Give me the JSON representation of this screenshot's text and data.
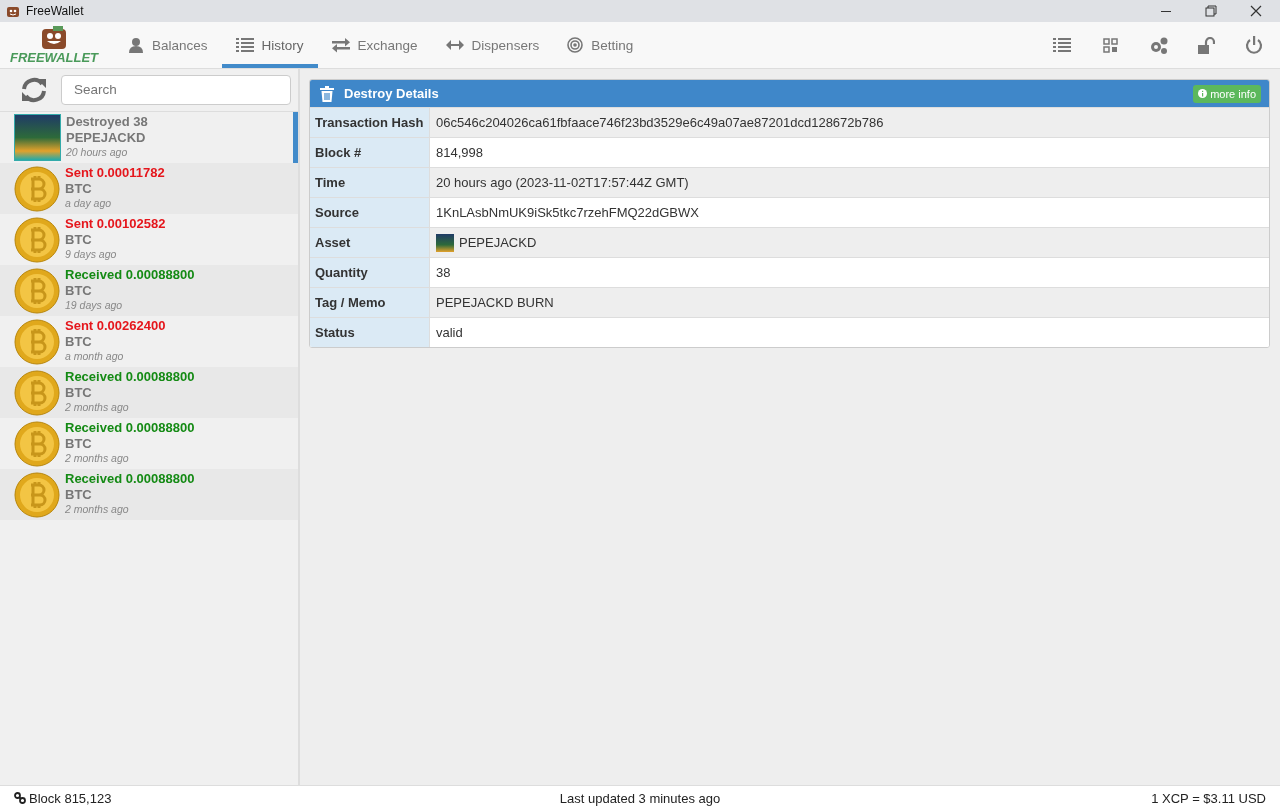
{
  "window": {
    "title": "FreeWallet"
  },
  "logo": {
    "text": "FREEWALLET"
  },
  "tabs": [
    {
      "label": "Balances",
      "selected": false
    },
    {
      "label": "History",
      "selected": true
    },
    {
      "label": "Exchange",
      "selected": false
    },
    {
      "label": "Dispensers",
      "selected": false
    },
    {
      "label": "Betting",
      "selected": false
    }
  ],
  "search": {
    "placeholder": "Search"
  },
  "history": [
    {
      "kind": "destroy",
      "title": "Destroyed 38",
      "asset": "PEPEJACKD",
      "time": "20 hours ago",
      "selected": true
    },
    {
      "kind": "sent",
      "title": "Sent 0.00011782",
      "asset": "BTC",
      "time": "a day ago",
      "selected": false
    },
    {
      "kind": "sent",
      "title": "Sent 0.00102582",
      "asset": "BTC",
      "time": "9 days ago",
      "selected": false
    },
    {
      "kind": "received",
      "title": "Received 0.00088800",
      "asset": "BTC",
      "time": "19 days ago",
      "selected": false
    },
    {
      "kind": "sent",
      "title": "Sent 0.00262400",
      "asset": "BTC",
      "time": "a month ago",
      "selected": false
    },
    {
      "kind": "received",
      "title": "Received 0.00088800",
      "asset": "BTC",
      "time": "2 months ago",
      "selected": false
    },
    {
      "kind": "received",
      "title": "Received 0.00088800",
      "asset": "BTC",
      "time": "2 months ago",
      "selected": false
    },
    {
      "kind": "received",
      "title": "Received 0.00088800",
      "asset": "BTC",
      "time": "2 months ago",
      "selected": false
    }
  ],
  "details": {
    "title": "Destroy Details",
    "more_info": "more info",
    "rows": [
      {
        "label": "Transaction Hash",
        "value": "06c546c204026ca61fbfaace746f23bd3529e6c49a07ae87201dcd128672b786"
      },
      {
        "label": "Block #",
        "value": "814,998"
      },
      {
        "label": "Time",
        "value": "20 hours ago (2023-11-02T17:57:44Z GMT)"
      },
      {
        "label": "Source",
        "value": "1KnLAsbNmUK9iSk5tkc7rzehFMQ22dGBWX"
      },
      {
        "label": "Asset",
        "value": "PEPEJACKD",
        "kind": "asset"
      },
      {
        "label": "Quantity",
        "value": "38"
      },
      {
        "label": "Tag / Memo",
        "value": "PEPEJACKD BURN"
      },
      {
        "label": "Status",
        "value": "valid"
      }
    ]
  },
  "status_bar": {
    "block": "Block 815,123",
    "updated": "Last updated 3 minutes ago",
    "price": "1 XCP = $3.11 USD"
  }
}
